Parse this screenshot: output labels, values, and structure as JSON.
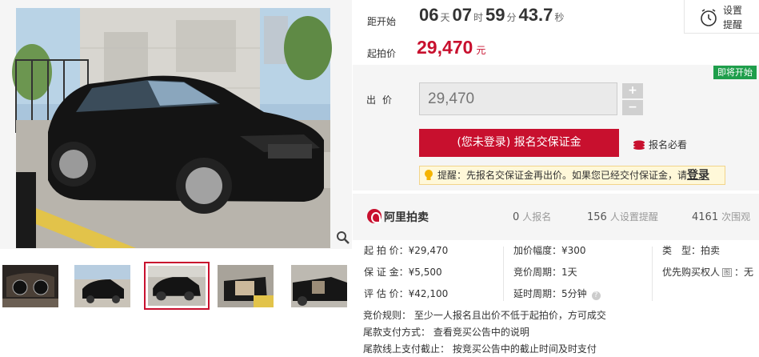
{
  "gallery": {
    "active_index": 2,
    "thumbnails": [
      "dashboard",
      "car-front-parked",
      "car-side",
      "car-interior-doors-open",
      "car-rear-doors-open"
    ]
  },
  "countdown": {
    "label": "距开始",
    "days": "06",
    "days_unit": "天",
    "hours": "07",
    "hours_unit": "时",
    "minutes": "59",
    "minutes_unit": "分",
    "seconds": "43.7",
    "seconds_unit": "秒"
  },
  "start_price": {
    "label": "起拍价",
    "value": "29,470",
    "unit": "元"
  },
  "reminder": {
    "line1": "设置",
    "line2": "提醒"
  },
  "bid": {
    "badge": "即将开始",
    "label": "出价",
    "placeholder": "29,470",
    "plus": "+",
    "minus": "−",
    "deposit_button": "(您未登录) 报名交保证金",
    "must_read": "报名必看",
    "tip_text": "提醒：先报名交保证金再出价。如果您已经交付保证金，请",
    "tip_link": "登录"
  },
  "stats": {
    "brand": "阿里拍卖",
    "signups": "0",
    "signups_label": "人报名",
    "reminders": "156",
    "reminders_label": "人设置提醒",
    "views": "4161",
    "views_label": "次围观"
  },
  "details": {
    "start_price_k": "起 拍 价：",
    "start_price_v": "¥29,470",
    "deposit_k": "保 证 金：",
    "deposit_v": "¥5,500",
    "estimate_k": "评 估 价：",
    "estimate_v": "¥42,100",
    "increment_k": "加价幅度：",
    "increment_v": "¥300",
    "cycle_k": "竞价周期：",
    "cycle_v": "1天",
    "delay_k": "延时周期：",
    "delay_v": "5分钟",
    "type_k": "类　型：",
    "type_v": "拍卖",
    "priority_k": "优先购买权人",
    "priority_tag": "图",
    "priority_v": "：无",
    "rule1_k": "竞价规则：",
    "rule1_v": "至少一人报名且出价不低于起拍价，方可成交",
    "rule2_k": "尾款支付方式：",
    "rule2_v": "查看竞买公告中的说明",
    "rule3_k": "尾款线上支付截止：",
    "rule3_v": "按竞买公告中的截止时间及时支付"
  },
  "colors": {
    "accent": "#c8102e",
    "badge": "#1e9e4b",
    "panel": "#f5f5f5"
  }
}
